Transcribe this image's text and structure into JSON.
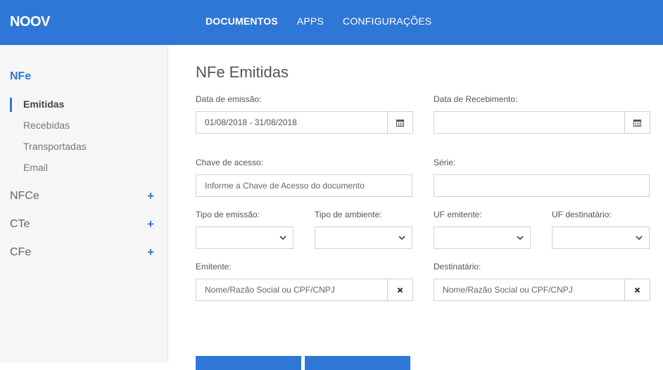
{
  "header": {
    "logo": "NOOV",
    "nav": [
      "DOCUMENTOS",
      "APPS",
      "CONFIGURAÇÕES"
    ]
  },
  "sidebar": {
    "title": "NFe",
    "sub_items": [
      "Emitidas",
      "Recebidas",
      "Transportadas",
      "Email"
    ],
    "groups": [
      "NFCe",
      "CTe",
      "CFe"
    ],
    "plus": "+"
  },
  "main": {
    "title": "NFe Emitidas",
    "data_emissao": {
      "label": "Data de emissão:",
      "value": "01/08/2018 - 31/08/2018"
    },
    "data_recebimento": {
      "label": "Data de Recebimento:",
      "value": ""
    },
    "chave": {
      "label": "Chave de acesso:",
      "placeholder": "Informe a Chave de Acesso do documento"
    },
    "serie": {
      "label": "Série:",
      "value": ""
    },
    "tipo_emissao": {
      "label": "Tipo de emissão:"
    },
    "tipo_ambiente": {
      "label": "Tipo de ambiente:"
    },
    "uf_emitente": {
      "label": "UF emitente:"
    },
    "uf_destinatario": {
      "label": "UF destinatário:"
    },
    "emitente": {
      "label": "Emitente:",
      "placeholder": "Nome/Razão Social ou CPF/CNPJ"
    },
    "destinatario": {
      "label": "Destinatário:",
      "placeholder": "Nome/Razão Social ou CPF/CNPJ"
    }
  },
  "icons": {
    "calendar": "calendar-icon",
    "clear": "clear-icon",
    "chevron": "chevron-down-icon"
  },
  "colors": {
    "brand": "#2f77d6",
    "sidebar_bg": "#f6f6f6"
  }
}
